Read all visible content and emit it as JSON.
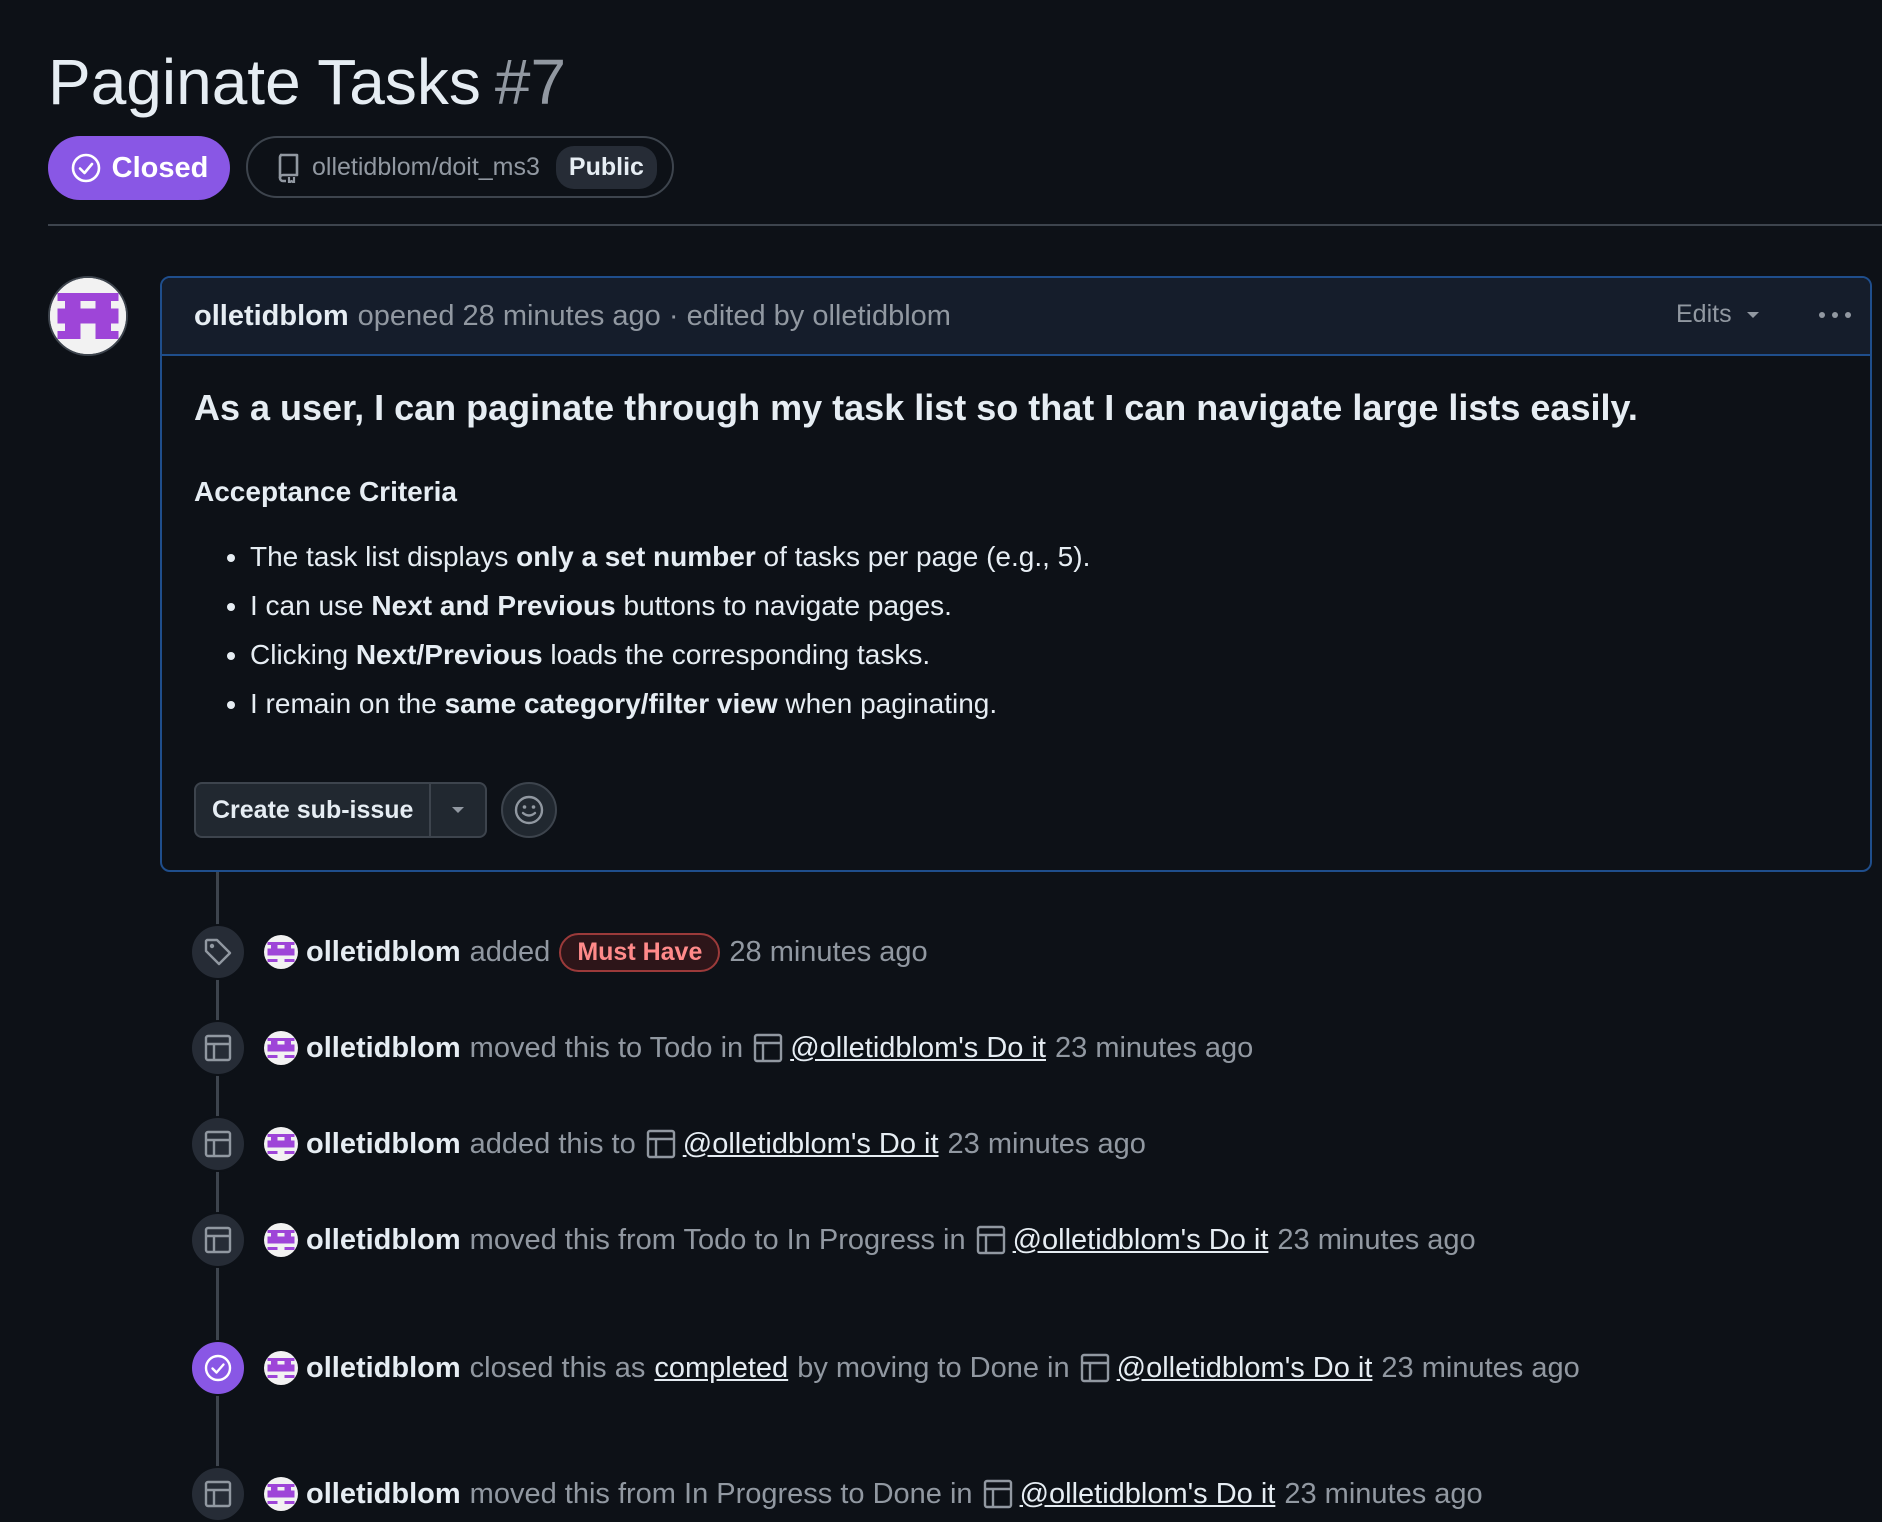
{
  "issue": {
    "title": "Paginate Tasks",
    "number": "#7",
    "state": "Closed",
    "repo": "olletidblom/doit_ms3",
    "visibility": "Public"
  },
  "comment": {
    "author": "olletidblom",
    "meta": "opened 28 minutes ago · edited by olletidblom",
    "edits_label": "Edits",
    "heading": "As a user, I can paginate through my task list so that I can navigate large lists easily.",
    "subheading": "Acceptance Criteria",
    "criteria": [
      {
        "pre": "The task list displays ",
        "bold": "only a set number",
        "post": " of tasks per page (e.g., 5)."
      },
      {
        "pre": "I can use ",
        "bold": "Next and Previous",
        "post": " buttons to navigate pages."
      },
      {
        "pre": "Clicking ",
        "bold": "Next/Previous",
        "post": " loads the corresponding tasks."
      },
      {
        "pre": "I remain on the ",
        "bold": "same category/filter view",
        "post": " when paginating."
      }
    ],
    "create_sub_issue_label": "Create sub-issue"
  },
  "timeline": [
    {
      "actor": "olletidblom",
      "text1": "added",
      "label": "Must Have",
      "text2": "",
      "link": "",
      "time": "28 minutes ago",
      "icon": "tag-icon"
    },
    {
      "actor": "olletidblom",
      "text1": "moved this to Todo in",
      "link": "@olletidblom's Do it",
      "time": "23 minutes ago",
      "icon": "project-icon"
    },
    {
      "actor": "olletidblom",
      "text1": "added this to",
      "link": "@olletidblom's Do it",
      "time": "23 minutes ago",
      "icon": "project-icon"
    },
    {
      "actor": "olletidblom",
      "text1": "moved this from Todo to In Progress in",
      "link": "@olletidblom's Do it",
      "time": "23 minutes ago",
      "icon": "project-icon"
    },
    {
      "actor": "olletidblom",
      "text1": "closed this as",
      "link_mid": "completed",
      "text2": "by moving to Done in",
      "link": "@olletidblom's Do it",
      "time": "23 minutes ago",
      "icon": "check-circle-icon"
    },
    {
      "actor": "olletidblom",
      "text1": "moved this from In Progress to Done in",
      "link": "@olletidblom's Do it",
      "time": "23 minutes ago",
      "icon": "project-icon"
    }
  ],
  "colors": {
    "closed": "#8957e5",
    "label_must_have": "#ff8a8a",
    "link": "#e6edf3"
  }
}
